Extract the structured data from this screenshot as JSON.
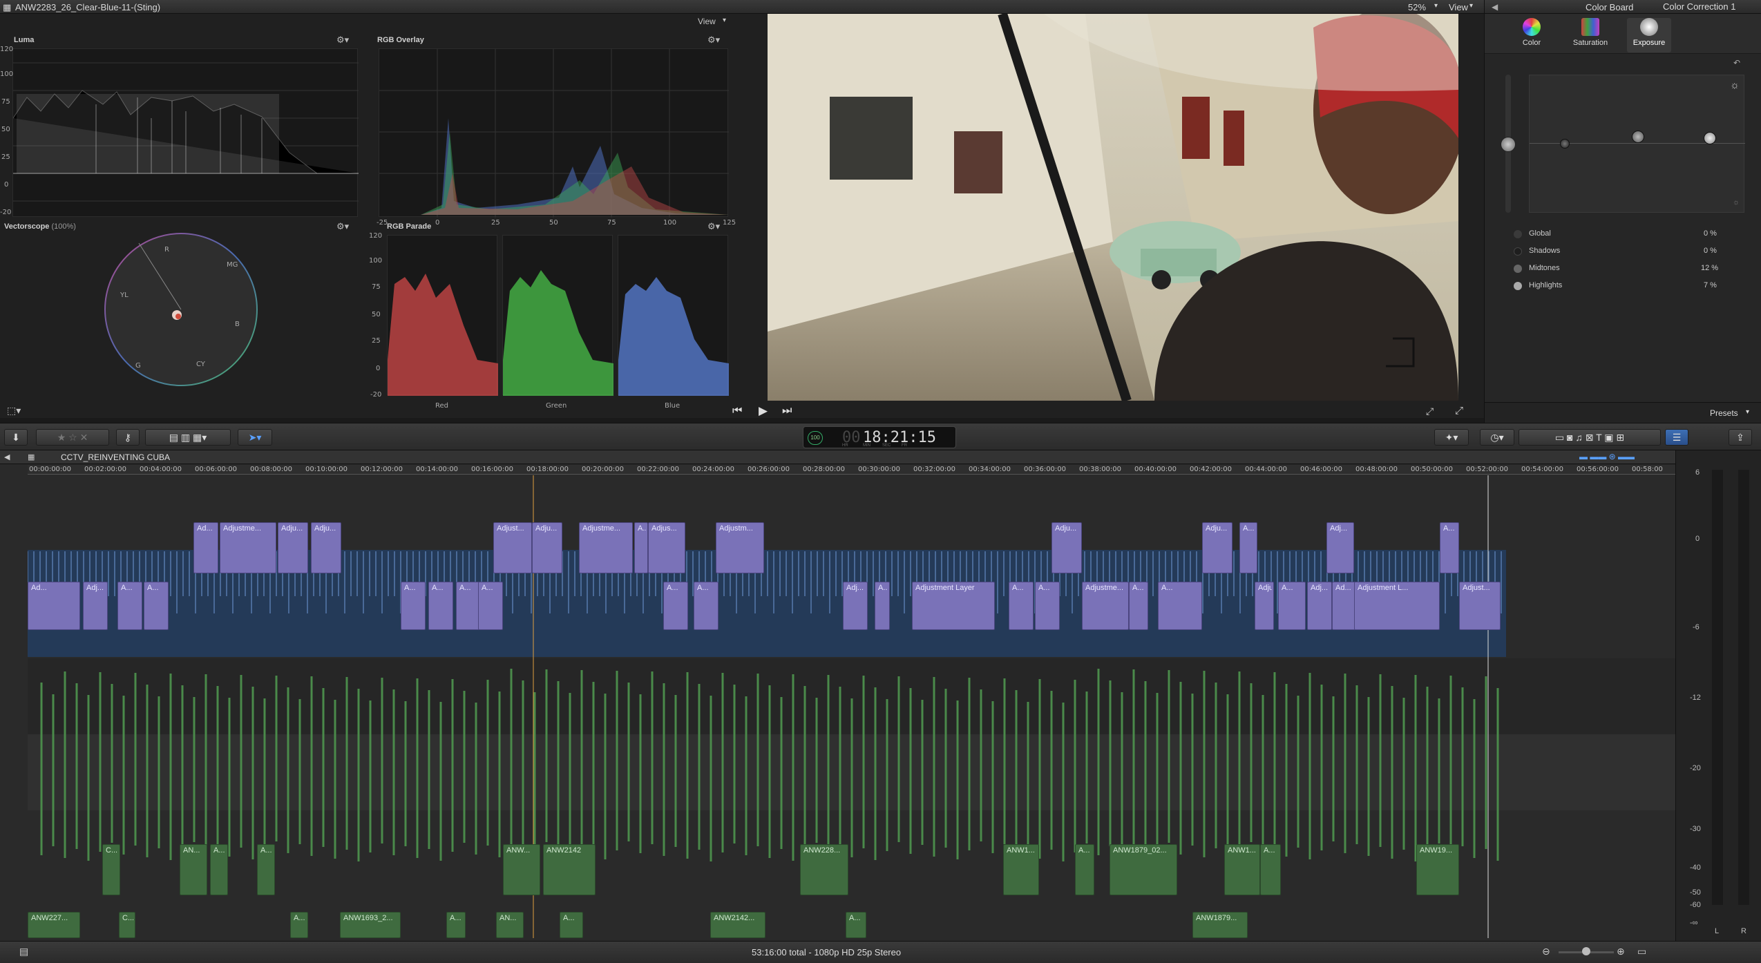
{
  "window": {
    "clip_title": "ANW2283_26_Clear-Blue-11-(Sting)",
    "viewer_view_label": "View",
    "zoom": "52%",
    "viewer_view2": "View",
    "inspector_title": "Color Board",
    "correction_title": "Color Correction 1"
  },
  "scopes": {
    "luma": {
      "title": "Luma",
      "scale": [
        "120",
        "100",
        "75",
        "50",
        "25",
        "0",
        "-20"
      ]
    },
    "rgb_overlay": {
      "title": "RGB Overlay",
      "x_scale": [
        "-25",
        "0",
        "25",
        "50",
        "75",
        "100",
        "125"
      ]
    },
    "vectorscope": {
      "title": "Vectorscope",
      "subtitle": "(100%)",
      "labels": {
        "r": "R",
        "mg": "MG",
        "yl": "YL",
        "b": "B",
        "g": "G",
        "cy": "CY"
      }
    },
    "rgb_parade": {
      "title": "RGB Parade",
      "scale": [
        "120",
        "100",
        "75",
        "50",
        "25",
        "0",
        "-20"
      ],
      "channels": [
        "Red",
        "Green",
        "Blue"
      ]
    }
  },
  "inspector": {
    "tabs": [
      {
        "label": "Color"
      },
      {
        "label": "Saturation"
      },
      {
        "label": "Exposure"
      }
    ],
    "rows": [
      {
        "label": "Global",
        "value": "0 %"
      },
      {
        "label": "Shadows",
        "value": "0 %"
      },
      {
        "label": "Midtones",
        "value": "12 %"
      },
      {
        "label": "Highlights",
        "value": "7 %"
      }
    ],
    "presets_label": "Presets"
  },
  "toolbar": {
    "timecode": "18:21:15",
    "timecode_prefix": "00",
    "timecode_units": [
      "HR",
      "MIN",
      "SEC",
      "FR"
    ],
    "percent": "100"
  },
  "timeline": {
    "project_name": "CCTV_REINVENTING CUBA",
    "ruler": [
      "00:00:00:00",
      "00:02:00:00",
      "00:04:00:00",
      "00:06:00:00",
      "00:08:00:00",
      "00:10:00:00",
      "00:12:00:00",
      "00:14:00:00",
      "00:16:00:00",
      "00:18:00:00",
      "00:20:00:00",
      "00:22:00:00",
      "00:24:00:00",
      "00:26:00:00",
      "00:28:00:00",
      "00:30:00:00",
      "00:32:00:00",
      "00:34:00:00",
      "00:36:00:00",
      "00:38:00:00",
      "00:40:00:00",
      "00:42:00:00",
      "00:44:00:00",
      "00:46:00:00",
      "00:48:00:00",
      "00:50:00:00",
      "00:52:00:00",
      "00:54:00:00",
      "00:56:00:00",
      "00:58:00"
    ],
    "adj_top": [
      {
        "label": "Ad..."
      },
      {
        "label": "Adjustme..."
      },
      {
        "label": "Adju..."
      },
      {
        "label": "Adju..."
      },
      {
        "label": "Adjust..."
      },
      {
        "label": "Adju..."
      },
      {
        "label": "Adjustme..."
      },
      {
        "label": "A..."
      },
      {
        "label": "Adjus..."
      },
      {
        "label": "Adjustm..."
      },
      {
        "label": "Adju..."
      },
      {
        "label": "Adju..."
      },
      {
        "label": "A..."
      },
      {
        "label": "Adj..."
      },
      {
        "label": "A..."
      }
    ],
    "adj_mid": [
      {
        "label": "Ad..."
      },
      {
        "label": "Adj..."
      },
      {
        "label": "A..."
      },
      {
        "label": "A..."
      },
      {
        "label": "A..."
      },
      {
        "label": "A..."
      },
      {
        "label": "A..."
      },
      {
        "label": "A..."
      },
      {
        "label": "A..."
      },
      {
        "label": "A..."
      },
      {
        "label": "Adj..."
      },
      {
        "label": "A..."
      },
      {
        "label": "Adjustment Layer"
      },
      {
        "label": "A..."
      },
      {
        "label": "A..."
      },
      {
        "label": "Adjustme..."
      },
      {
        "label": "A..."
      },
      {
        "label": "A..."
      },
      {
        "label": "Adjust..."
      },
      {
        "label": "A..."
      },
      {
        "label": "Adj..."
      },
      {
        "label": "Ad..."
      },
      {
        "label": "Adjustment L..."
      },
      {
        "label": "Adjust..."
      }
    ],
    "green_upper": [
      {
        "label": "C..."
      },
      {
        "label": "AN..."
      },
      {
        "label": "A..."
      },
      {
        "label": "A..."
      },
      {
        "label": "ANW..."
      },
      {
        "label": "ANW2142"
      },
      {
        "label": "ANW228..."
      },
      {
        "label": "ANW1..."
      },
      {
        "label": "A..."
      },
      {
        "label": "ANW1879_02..."
      },
      {
        "label": "ANW1..."
      },
      {
        "label": "A..."
      },
      {
        "label": "ANW19..."
      }
    ],
    "green_lower": [
      {
        "label": "ANW227..."
      },
      {
        "label": "C..."
      },
      {
        "label": "A..."
      },
      {
        "label": "ANW1693_2..."
      },
      {
        "label": "A..."
      },
      {
        "label": "AN..."
      },
      {
        "label": "A..."
      },
      {
        "label": "ANW2142..."
      },
      {
        "label": "A..."
      },
      {
        "label": "ANW1879..."
      }
    ],
    "meter_scale": [
      "6",
      "0",
      "-6",
      "-12",
      "-20",
      "-30",
      "-40",
      "-50",
      "-60",
      "-∞"
    ],
    "meter_channels": [
      "L",
      "R"
    ]
  },
  "status": {
    "summary": "53:16:00 total - 1080p HD 25p Stereo"
  }
}
